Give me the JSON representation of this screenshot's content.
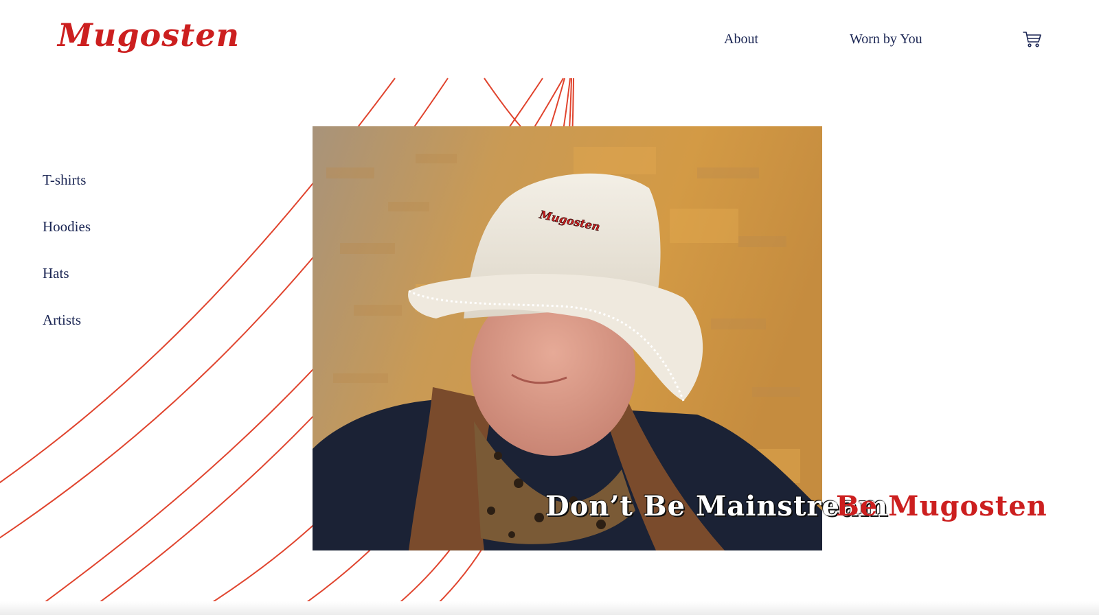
{
  "brand": {
    "logo": "Mugosten",
    "accent_color": "#cc1f1f",
    "nav_color": "#1a2553"
  },
  "header": {
    "nav": [
      {
        "label": "About"
      },
      {
        "label": "Worn by You"
      }
    ],
    "cart_icon": "shopping-cart-icon"
  },
  "sidebar": {
    "items": [
      {
        "label": "T-shirts"
      },
      {
        "label": "Hoodies"
      },
      {
        "label": "Hats"
      },
      {
        "label": "Artists"
      }
    ]
  },
  "hero": {
    "hat_logo": "Mugosten",
    "tagline_white": "Don’t Be Mainstream",
    "tagline_red": "Be Mugosten"
  }
}
